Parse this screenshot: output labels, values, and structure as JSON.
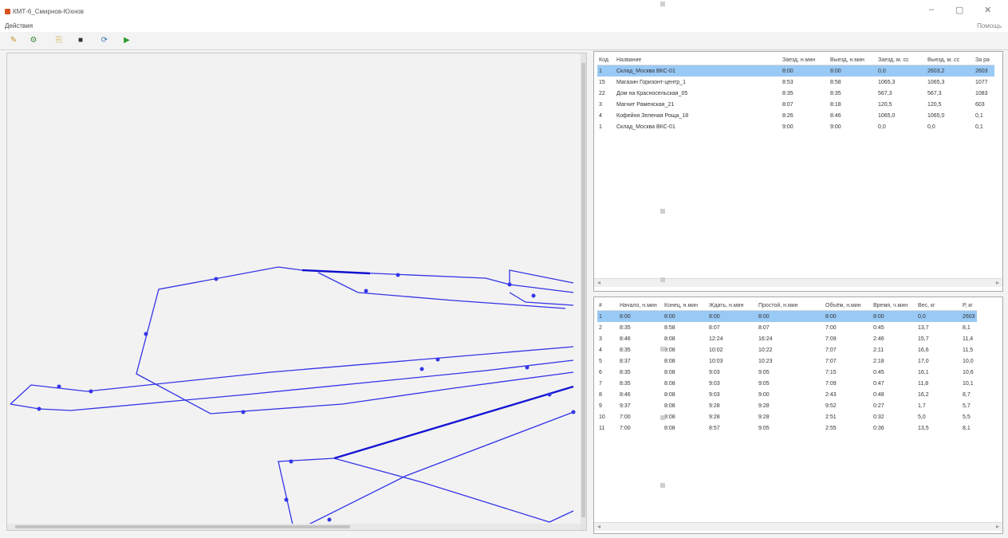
{
  "window": {
    "title": "КМТ-6_Смирнов-Юхнов",
    "minimize": "–",
    "maximize": "▢",
    "close": "✕"
  },
  "menu": {
    "item": "Действия",
    "right": "Помощь"
  },
  "toolbar": {
    "buttons": [
      {
        "name": "open-icon",
        "glyph": "✎"
      },
      {
        "name": "settings-icon",
        "glyph": "⚙"
      },
      {
        "name": "copy-icon",
        "glyph": "⎘"
      },
      {
        "name": "save-icon",
        "glyph": "■"
      },
      {
        "name": "refresh-icon",
        "glyph": "⟳"
      },
      {
        "name": "run-icon",
        "glyph": "▶"
      }
    ]
  },
  "top_table": {
    "headers": [
      "Код",
      "Название",
      "Заезд, н.мин",
      "Выезд, н.мин",
      "Заезд, м. сс",
      "Выезд, м. сс",
      "За ра"
    ],
    "rows": [
      [
        "1",
        "Склад_Москва ВКС-01",
        "8:00",
        "8:00",
        "0,0",
        "2603,2",
        "2603"
      ],
      [
        "15",
        "Магазин Горизонт-центр_1",
        "8:53",
        "8:58",
        "1065,3",
        "1065,3",
        "1077"
      ],
      [
        "22",
        "Дом на Красносельская_05",
        "8:35",
        "8:35",
        "567,3",
        "567,3",
        "1083"
      ],
      [
        "3",
        "Магнит Раменская_21",
        "8:07",
        "8:18",
        "120,5",
        "120,5",
        "603"
      ],
      [
        "4",
        "Кофейня Зеленая Роща_18",
        "8:26",
        "8:46",
        "1065,0",
        "1065,0",
        "0,1"
      ],
      [
        "1",
        "Склад_Москва ВКС-01",
        "9:00",
        "9:00",
        "0,0",
        "0,0",
        "0,1"
      ]
    ]
  },
  "bottom_table": {
    "headers": [
      "#",
      "Начало, н.мин",
      "Конец, н.мин",
      "Ждать, н.мин",
      "Простой, н.мин",
      "Объём, н.мин",
      "Время, ч.мин",
      "Вес, кг",
      "Р, кг"
    ],
    "rows": [
      [
        "1",
        "8:00",
        "8:00",
        "8:00",
        "8:00",
        "8:00",
        "8:00",
        "0,0",
        "2603"
      ],
      [
        "2",
        "8:35",
        "8:58",
        "8:07",
        "8:07",
        "7:00",
        "0:45",
        "13,7",
        "8,1"
      ],
      [
        "3",
        "8:46",
        "8:08",
        "12:24",
        "16:24",
        "7:09",
        "2:46",
        "15,7",
        "11,4"
      ],
      [
        "4",
        "8:35",
        "8:08",
        "10:02",
        "10:22",
        "7:07",
        "2:11",
        "16,6",
        "11,5"
      ],
      [
        "5",
        "8:37",
        "8:08",
        "10:03",
        "10:23",
        "7:07",
        "2:18",
        "17,0",
        "10,0"
      ],
      [
        "6",
        "8:35",
        "8:08",
        "9:03",
        "9:05",
        "7:15",
        "0:45",
        "16,1",
        "10,6"
      ],
      [
        "7",
        "8:35",
        "8:08",
        "9:03",
        "9:05",
        "7:09",
        "0:47",
        "11,8",
        "10,1"
      ],
      [
        "8",
        "8:46",
        "8:08",
        "9:03",
        "9:00",
        "2:43",
        "0:48",
        "16,2",
        "8,7"
      ],
      [
        "9",
        "9:37",
        "8:08",
        "9:28",
        "9:28",
        "9:52",
        "0:27",
        "1,7",
        "5,7"
      ],
      [
        "10",
        "7:00",
        "8:08",
        "9:28",
        "9:28",
        "2:51",
        "0:32",
        "5,0",
        "5,5"
      ],
      [
        "11",
        "7:00",
        "8:08",
        "8:57",
        "9:05",
        "2:55",
        "0:36",
        "13,5",
        "8,1"
      ]
    ]
  }
}
